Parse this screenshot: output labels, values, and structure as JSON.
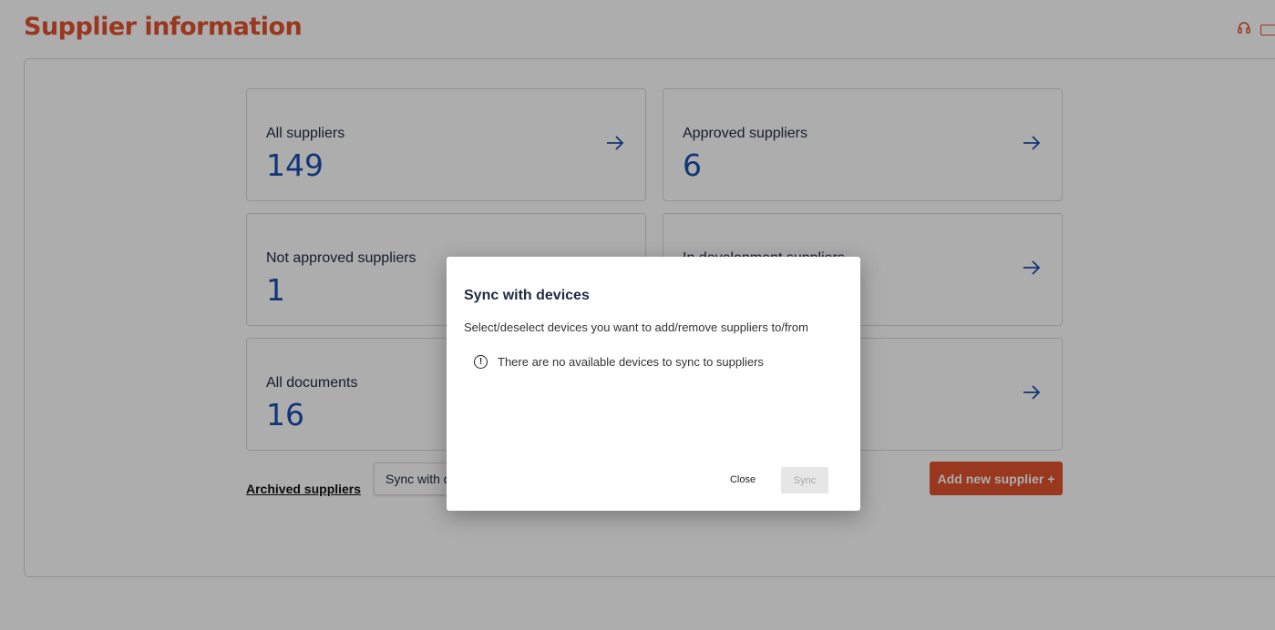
{
  "page": {
    "title": "Supplier information"
  },
  "top_icons": [
    "headset-icon",
    "book-icon"
  ],
  "cards": [
    {
      "label": "All suppliers",
      "count": "149"
    },
    {
      "label": "Approved suppliers",
      "count": "6"
    },
    {
      "label": "Not approved suppliers",
      "count": "1"
    },
    {
      "label": "In development suppliers",
      "count": ""
    },
    {
      "label": "All documents",
      "count": "16"
    },
    {
      "label": "",
      "count": ""
    }
  ],
  "actions": {
    "archived": "Archived suppliers",
    "sync": "Sync with devices",
    "add": "Add new supplier +"
  },
  "dialog": {
    "title": "Sync with devices",
    "description": "Select/deselect devices you want to add/remove suppliers to/from",
    "info": "There are no available devices to sync to suppliers",
    "close": "Close",
    "sync": "Sync"
  },
  "colors": {
    "brand": "#e2512f",
    "count": "#1b4fb0",
    "arrow": "#1b4fb0"
  }
}
